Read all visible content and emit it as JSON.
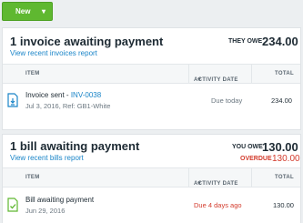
{
  "toolbar": {
    "new_label": "New",
    "new_caret": "▾"
  },
  "invoices": {
    "title": "1 invoice awaiting payment",
    "link": "View recent invoices report",
    "owe_label": "THEY OWE",
    "owe_amount": "234.00",
    "columns": {
      "item": "ITEM",
      "activity": "ACTIVITY DATE",
      "sort_caret": "▼",
      "total": "TOTAL"
    },
    "rows": [
      {
        "title": "Invoice sent",
        "sep": " - ",
        "ref": "INV-0038",
        "sub": "Jul 3, 2016, Ref: GB1-White",
        "status": "Due today",
        "total": "234.00"
      }
    ]
  },
  "bills": {
    "title": "1 bill awaiting payment",
    "link": "View recent bills report",
    "owe_label": "YOU OWE",
    "owe_amount": "130.00",
    "overdue_label": "OVERDUE",
    "overdue_amount": "130.00",
    "columns": {
      "item": "ITEM",
      "activity": "ACTIVITY DATE",
      "sort_caret": "▼",
      "total": "TOTAL"
    },
    "rows": [
      {
        "title": "Bill awaiting payment",
        "sub": "Jun 29, 2016",
        "status": "Due 4 days ago",
        "total": "130.00"
      }
    ]
  },
  "colors": {
    "accent_green": "#5fb830",
    "link_blue": "#1a85c8",
    "overdue_red": "#d33b2c"
  }
}
